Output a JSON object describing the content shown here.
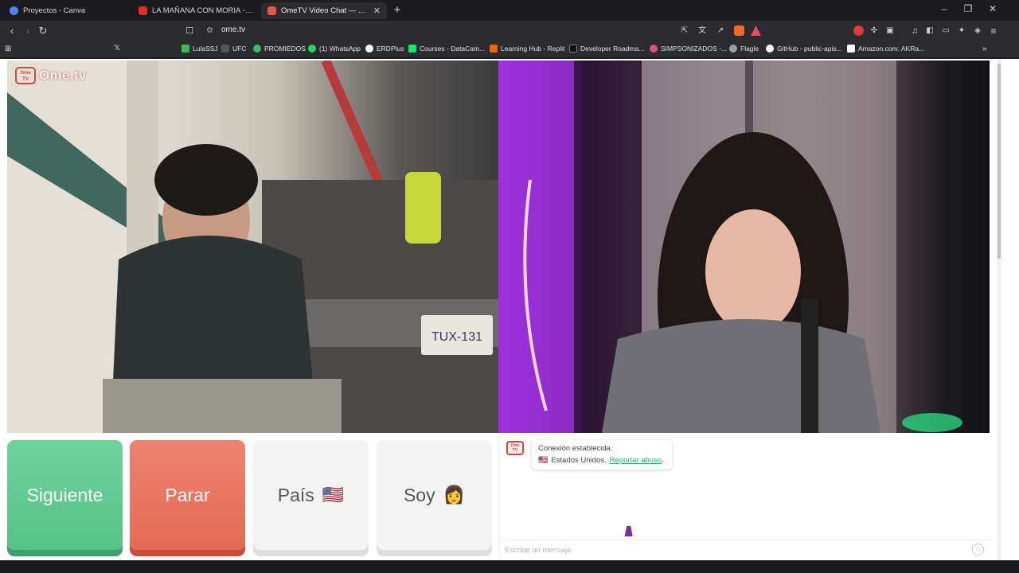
{
  "browser": {
    "tabs": [
      {
        "title": "Proyectos - Canva",
        "color": "#4c83f5",
        "active": false
      },
      {
        "title": "LA MAÑANA CON MORIA - PROGRAMA",
        "color": "#e52d27",
        "active": false
      },
      {
        "title": "OmeTV Video Chat — Omegle",
        "color": "#e4584a",
        "active": true
      }
    ],
    "new_tab_label": "+",
    "window_controls": {
      "minimize": "–",
      "maximize": "❐",
      "close": "✕"
    },
    "url": "ome.tv",
    "bookmarks": [
      {
        "label": "LulaSSJ",
        "color": "#3dbb5a"
      },
      {
        "label": "UFC",
        "color": "#666666"
      },
      {
        "label": "PROMIEDOS",
        "color": "#3dbb5a"
      },
      {
        "label": "(1) WhatsApp",
        "color": "#25d366"
      },
      {
        "label": "ERDPlus",
        "color": "#ffffff"
      },
      {
        "label": "Courses - DataCam...",
        "color": "#03ef62"
      },
      {
        "label": "Learning Hub - Replit",
        "color": "#f26207"
      },
      {
        "label": "Developer Roadma...",
        "color": "#111111"
      },
      {
        "label": "SIMPSONIZADOS -...",
        "color": "#e14c8f"
      },
      {
        "label": "Flagle",
        "color": "#9aa0a6"
      },
      {
        "label": "GitHub - public-apis...",
        "color": "#ffffff"
      },
      {
        "label": "Amazon.com: AKRa...",
        "color": "#ffffff"
      }
    ]
  },
  "app": {
    "logo_text": "Ome.tv",
    "logo_badge": "Ome TV",
    "buttons": {
      "next": "Siguiente",
      "stop": "Parar",
      "country": "País",
      "country_flag": "🇺🇸",
      "gender": "Soy",
      "gender_emoji": "👩"
    },
    "chat": {
      "status_line": "Conexión establecida.",
      "country_flag": "🇺🇸",
      "country_line": "Estados Unidos.",
      "report_link": "Reportar abuso",
      "report_suffix": ".",
      "input_placeholder": "Escribe un mensaje",
      "emoji_icon": "smile-icon"
    },
    "colors": {
      "next": "#5fcb8e",
      "stop": "#e9765f",
      "neutral": "#f3f3f3",
      "link": "#3aa57a"
    }
  }
}
